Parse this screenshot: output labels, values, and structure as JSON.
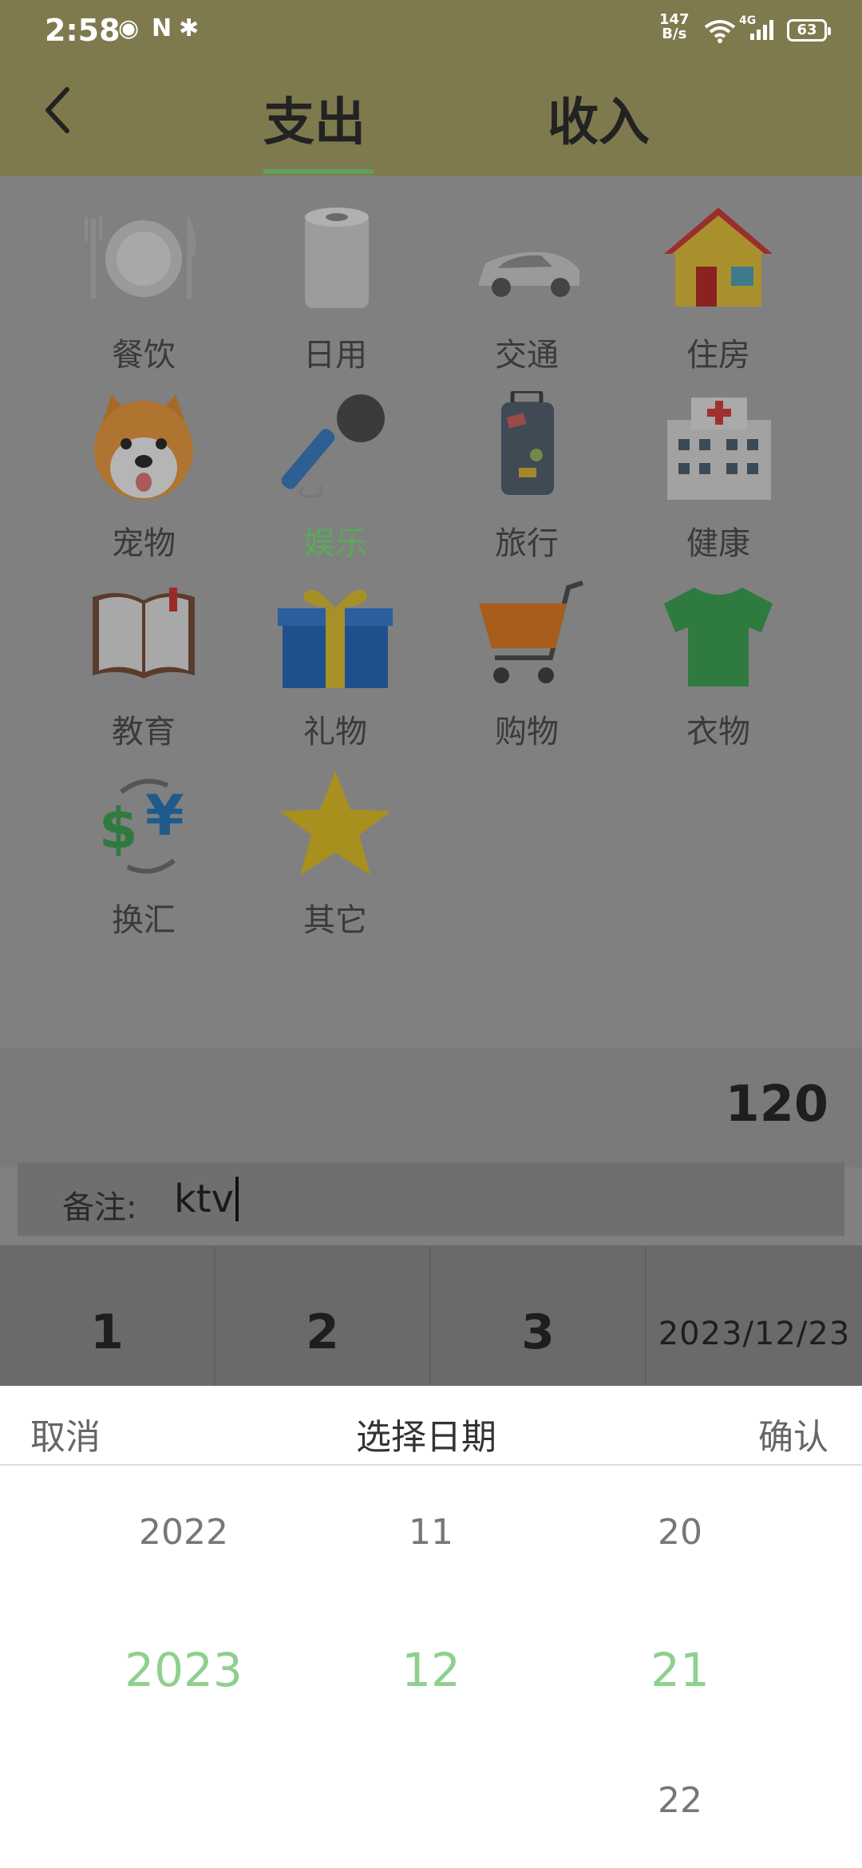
{
  "status_bar": {
    "time": "2:58",
    "net_speed_value": "147",
    "net_speed_unit": "B/s",
    "network": "4G",
    "battery": "63"
  },
  "header": {
    "tabs": [
      {
        "label": "支出"
      },
      {
        "label": "收入"
      }
    ]
  },
  "categories": [
    {
      "label": "餐饮",
      "icon": "dining-icon"
    },
    {
      "label": "日用",
      "icon": "tissue-roll-icon"
    },
    {
      "label": "交通",
      "icon": "car-icon"
    },
    {
      "label": "住房",
      "icon": "house-icon"
    },
    {
      "label": "宠物",
      "icon": "dog-icon"
    },
    {
      "label": "娱乐",
      "icon": "microphone-icon"
    },
    {
      "label": "旅行",
      "icon": "luggage-icon"
    },
    {
      "label": "健康",
      "icon": "hospital-icon"
    },
    {
      "label": "教育",
      "icon": "book-icon"
    },
    {
      "label": "礼物",
      "icon": "gift-icon"
    },
    {
      "label": "购物",
      "icon": "shopping-cart-icon"
    },
    {
      "label": "衣物",
      "icon": "tshirt-icon"
    },
    {
      "label": "换汇",
      "icon": "currency-exchange-icon"
    },
    {
      "label": "其它",
      "icon": "star-icon"
    }
  ],
  "amount": "120",
  "note": {
    "label": "备注:",
    "value": "ktv"
  },
  "keypad": {
    "keys": [
      "1",
      "2",
      "3"
    ],
    "date": "2023/12/23"
  },
  "date_picker": {
    "cancel": "取消",
    "title": "选择日期",
    "confirm": "确认",
    "year": {
      "prev": "2022",
      "selected": "2023"
    },
    "month": {
      "prev": "11",
      "selected": "12"
    },
    "day": {
      "prev": "20",
      "selected": "21",
      "next": "22"
    }
  },
  "colors": {
    "header_bg": "#7f7a4e",
    "selected": "#8ed08e",
    "active_label": "#5aa85a"
  }
}
